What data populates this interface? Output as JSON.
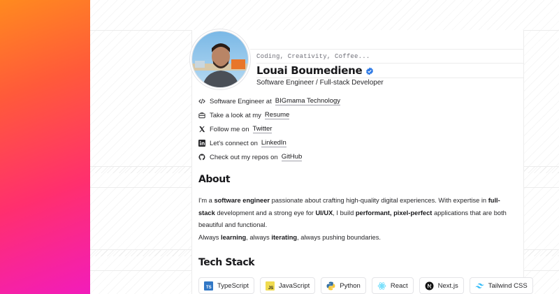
{
  "profile": {
    "tagline": "Coding, Creativity, Coffee...",
    "name": "Louai Boumediene",
    "role": "Software Engineer / Full-stack Developer"
  },
  "links": [
    {
      "icon": "code-icon",
      "prefix": "Software Engineer at",
      "link": "BIGmama Technology"
    },
    {
      "icon": "briefcase-icon",
      "prefix": "Take a look at my",
      "link": "Resume"
    },
    {
      "icon": "x-logo-icon",
      "prefix": "Follow me on",
      "link": "Twitter"
    },
    {
      "icon": "linkedin-icon",
      "prefix": "Let's connect on",
      "link": "LinkedIn"
    },
    {
      "icon": "github-icon",
      "prefix": "Check out my repos on",
      "link": "GitHub"
    }
  ],
  "about": {
    "title": "About",
    "p1_a": "I'm a ",
    "p1_b": "software engineer",
    "p1_c": " passionate about crafting high-quality digital experiences. With expertise in ",
    "p1_d": "full-stack",
    "p1_e": " development and a strong eye for ",
    "p1_f": "UI/UX",
    "p1_g": ", I build ",
    "p1_h": "performant, pixel-perfect",
    "p1_i": " applications that are both beautiful and functional.",
    "p2_a": "Always ",
    "p2_b": "learning",
    "p2_c": ", always ",
    "p2_d": "iterating",
    "p2_e": ", always pushing boundaries."
  },
  "tech": {
    "title": "Tech Stack",
    "items": [
      "TypeScript",
      "JavaScript",
      "Python",
      "React",
      "Next.js",
      "Tailwind CSS"
    ]
  },
  "colors": {
    "gradient_top": "#ff8a1f",
    "gradient_bottom": "#f21cbb",
    "verified": "#2f7ae5",
    "typescript": "#3178c6",
    "javascript": "#f0db4f",
    "react": "#61dafb",
    "tailwind": "#38bdf8"
  }
}
